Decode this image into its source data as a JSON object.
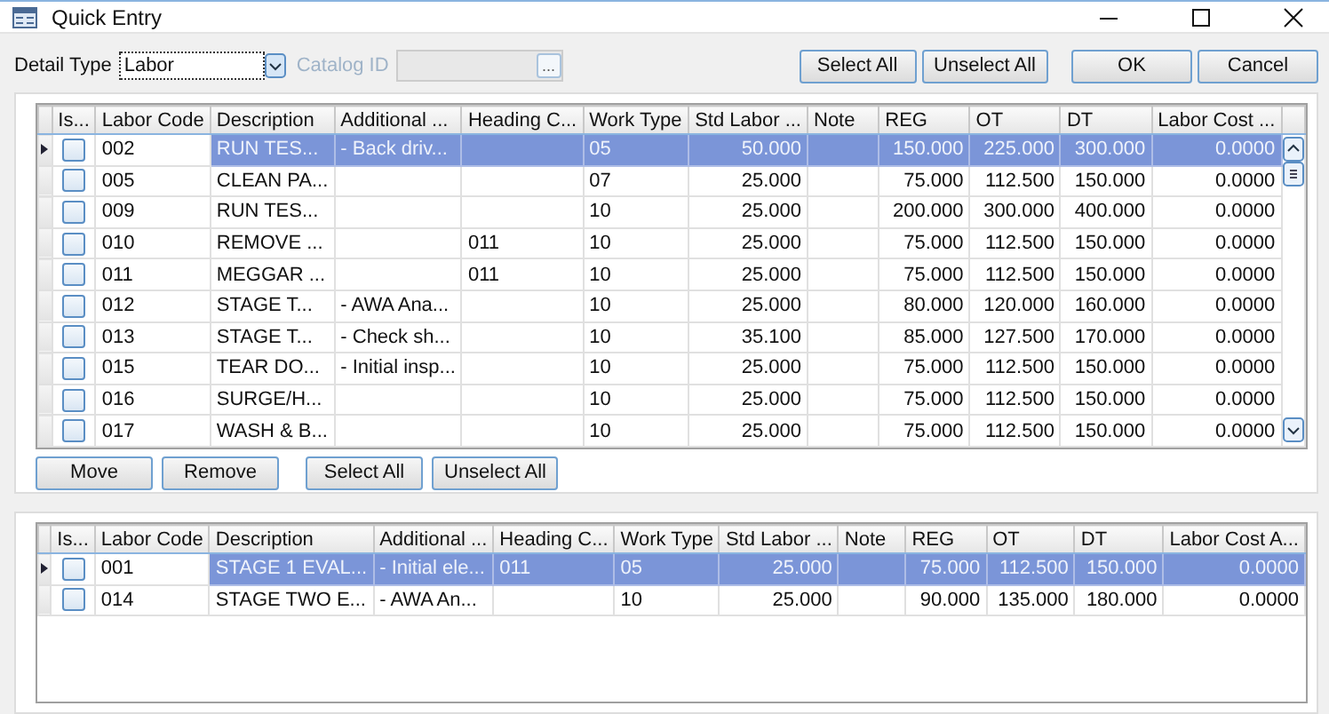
{
  "window": {
    "title": "Quick Entry"
  },
  "toolbar": {
    "detail_type_label": "Detail Type",
    "detail_type_value": "Labor",
    "catalog_label": "Catalog ID",
    "catalog_disabled": true,
    "browse_label": "...",
    "buttons": [
      "Select All",
      "Unselect All",
      "OK",
      "Cancel"
    ]
  },
  "grids": [
    {
      "columns": [
        {
          "label": "Is...",
          "kind": "check"
        },
        {
          "label": "Labor Code",
          "kind": "text"
        },
        {
          "label": "Description",
          "kind": "text"
        },
        {
          "label": "Additional ...",
          "kind": "text"
        },
        {
          "label": "Heading C...",
          "kind": "text"
        },
        {
          "label": "Work Type",
          "kind": "text"
        },
        {
          "label": "Std Labor ...",
          "kind": "number"
        },
        {
          "label": "Note",
          "kind": "text"
        },
        {
          "label": "REG",
          "kind": "number"
        },
        {
          "label": "OT",
          "kind": "number"
        },
        {
          "label": "DT",
          "kind": "number"
        },
        {
          "label": "Labor Cost ...",
          "kind": "number"
        }
      ],
      "rows": [
        {
          "selected": true,
          "checked": false,
          "cells": [
            "",
            "002",
            "RUN TES...",
            "- Back driv...",
            "",
            "05",
            "50.000",
            "",
            "150.000",
            "225.000",
            "300.000",
            "0.0000"
          ]
        },
        {
          "selected": false,
          "checked": false,
          "cells": [
            "",
            "005",
            "CLEAN PA...",
            "",
            "",
            "07",
            "25.000",
            "",
            "75.000",
            "112.500",
            "150.000",
            "0.0000"
          ]
        },
        {
          "selected": false,
          "checked": false,
          "cells": [
            "",
            "009",
            "RUN TES...",
            "",
            "",
            "10",
            "25.000",
            "",
            "200.000",
            "300.000",
            "400.000",
            "0.0000"
          ]
        },
        {
          "selected": false,
          "checked": false,
          "cells": [
            "",
            "010",
            "REMOVE ...",
            "",
            "011",
            "10",
            "25.000",
            "",
            "75.000",
            "112.500",
            "150.000",
            "0.0000"
          ]
        },
        {
          "selected": false,
          "checked": false,
          "cells": [
            "",
            "011",
            "MEGGAR ...",
            "",
            "011",
            "10",
            "25.000",
            "",
            "75.000",
            "112.500",
            "150.000",
            "0.0000"
          ]
        },
        {
          "selected": false,
          "checked": false,
          "cells": [
            "",
            "012",
            "STAGE T...",
            "- AWA Ana...",
            "",
            "10",
            "25.000",
            "",
            "80.000",
            "120.000",
            "160.000",
            "0.0000"
          ]
        },
        {
          "selected": false,
          "checked": false,
          "cells": [
            "",
            "013",
            "STAGE T...",
            "- Check sh...",
            "",
            "10",
            "35.100",
            "",
            "85.000",
            "127.500",
            "170.000",
            "0.0000"
          ]
        },
        {
          "selected": false,
          "checked": false,
          "cells": [
            "",
            "015",
            "TEAR DO...",
            "- Initial insp...",
            "",
            "10",
            "25.000",
            "",
            "75.000",
            "112.500",
            "150.000",
            "0.0000"
          ]
        },
        {
          "selected": false,
          "checked": false,
          "cells": [
            "",
            "016",
            "SURGE/H...",
            "",
            "",
            "10",
            "25.000",
            "",
            "75.000",
            "112.500",
            "150.000",
            "0.0000"
          ]
        },
        {
          "selected": false,
          "checked": false,
          "cells": [
            "",
            "017",
            "WASH & B...",
            "",
            "",
            "10",
            "25.000",
            "",
            "75.000",
            "112.500",
            "150.000",
            "0.0000"
          ]
        }
      ],
      "scrollbar": true,
      "buttons": [
        "Move",
        "Remove",
        "Select All",
        "Unselect All"
      ]
    },
    {
      "columns": [
        {
          "label": "Is...",
          "kind": "check"
        },
        {
          "label": "Labor Code",
          "kind": "text"
        },
        {
          "label": "Description",
          "kind": "text"
        },
        {
          "label": "Additional ...",
          "kind": "text"
        },
        {
          "label": "Heading C...",
          "kind": "text"
        },
        {
          "label": "Work Type",
          "kind": "text"
        },
        {
          "label": "Std Labor ...",
          "kind": "number"
        },
        {
          "label": "Note",
          "kind": "text"
        },
        {
          "label": "REG",
          "kind": "number"
        },
        {
          "label": "OT",
          "kind": "number"
        },
        {
          "label": "DT",
          "kind": "number"
        },
        {
          "label": "Labor Cost A...",
          "kind": "number"
        }
      ],
      "rows": [
        {
          "selected": true,
          "checked": false,
          "cells": [
            "",
            "001",
            "STAGE 1 EVAL...",
            "- Initial ele...",
            "011",
            "05",
            "25.000",
            "",
            "75.000",
            "112.500",
            "150.000",
            "0.0000"
          ]
        },
        {
          "selected": false,
          "checked": false,
          "cells": [
            "",
            "014",
            "STAGE TWO E...",
            "- AWA An...",
            "",
            "10",
            "25.000",
            "",
            "90.000",
            "135.000",
            "180.000",
            "0.0000"
          ]
        }
      ],
      "scrollbar": false
    }
  ]
}
